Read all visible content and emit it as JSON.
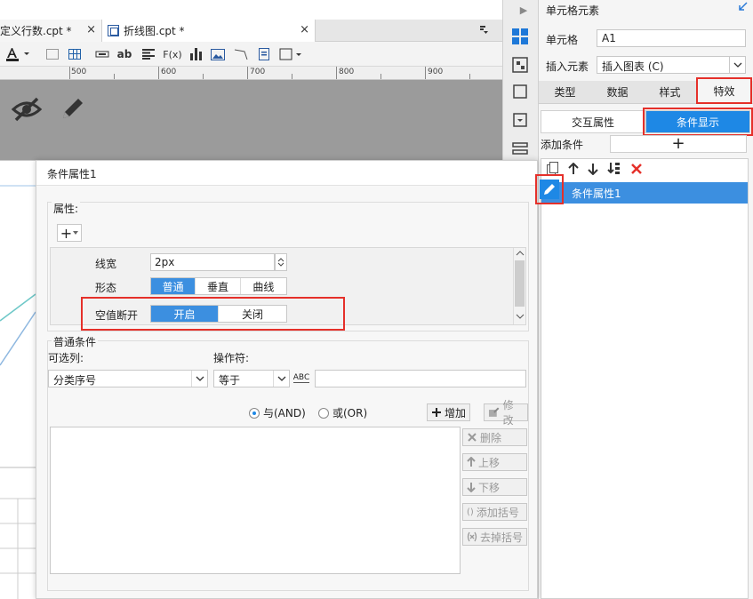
{
  "tabs": [
    {
      "label": "定义行数.cpt *",
      "close": "×"
    },
    {
      "label": "折线图.cpt *",
      "close": "×"
    }
  ],
  "ruler": {
    "labels": [
      "500",
      "600",
      "700",
      "800",
      "900"
    ]
  },
  "toolbar": {
    "text_ab": "ab",
    "text_fx": "F(x)"
  },
  "right_panel": {
    "title": "单元格元素",
    "cell_label": "单元格",
    "cell_value": "A1",
    "insert_label": "插入元素",
    "insert_value": "插入图表 (C)",
    "tabs": [
      "类型",
      "数据",
      "样式",
      "特效"
    ],
    "subtabs": [
      "交互属性",
      "条件显示"
    ],
    "add_condition_label": "添加条件",
    "add_condition_btn": "+",
    "list_item": "条件属性1"
  },
  "dialog": {
    "title": "条件属性1",
    "attr_legend": "属性:",
    "attr_add": "+",
    "line_width_label": "线宽",
    "line_width_value": "2px",
    "shape_label": "形态",
    "shape_options": [
      "普通",
      "垂直",
      "曲线"
    ],
    "null_break_label": "空值断开",
    "null_break_options": [
      "开启",
      "关闭"
    ],
    "cond_legend": "普通条件",
    "optional_col_label": "可选列:",
    "operator_label": "操作符:",
    "optional_col_value": "分类序号",
    "operator_value": "等于",
    "abc_label": "ABC",
    "radio_and": "与(AND)",
    "radio_or": "或(OR)",
    "btn_add": "增加",
    "btn_modify": "修改",
    "btn_delete": "删除",
    "btn_up": "上移",
    "btn_down": "下移",
    "btn_add_bracket": "添加括号",
    "btn_remove_bracket": "去掉括号"
  }
}
